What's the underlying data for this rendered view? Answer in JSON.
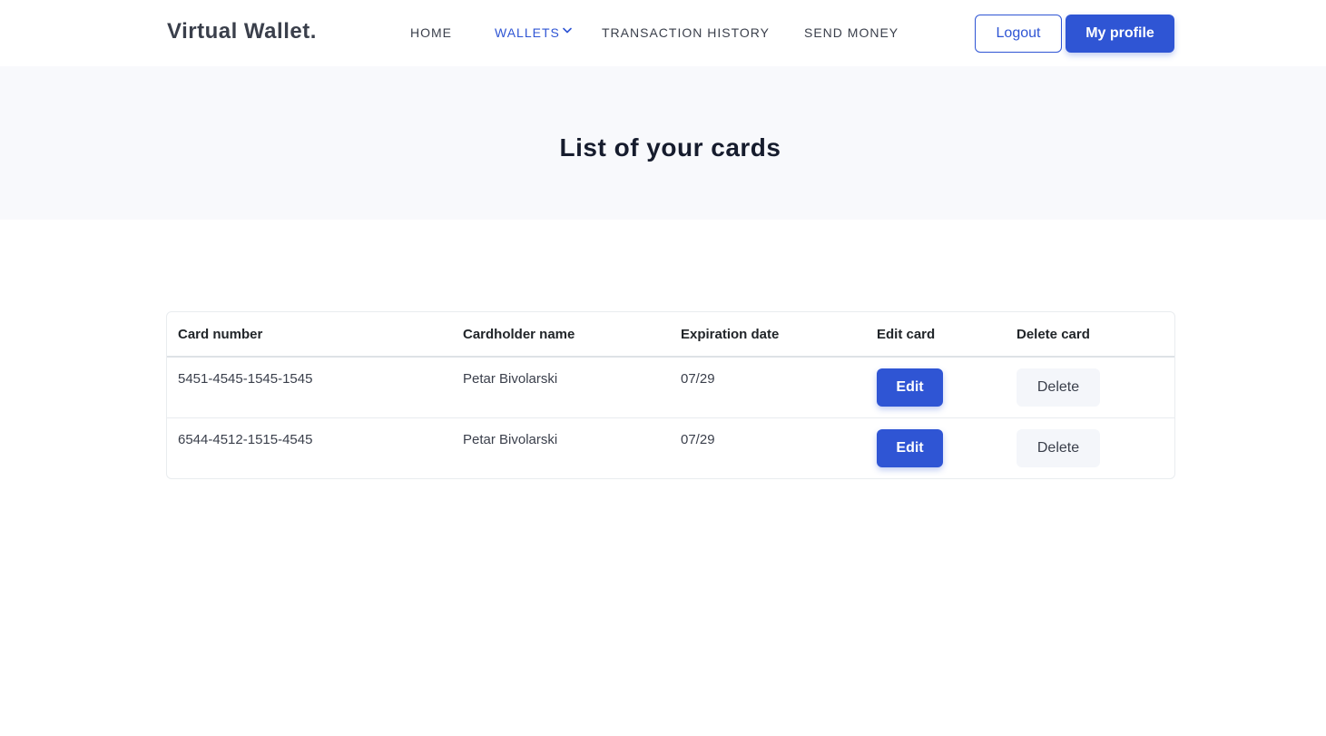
{
  "header": {
    "brand": "Virtual Wallet.",
    "nav": {
      "home": "HOME",
      "wallets": "WALLETS",
      "transaction_history": "TRANSACTION HISTORY",
      "send_money": "SEND MONEY"
    },
    "logout_label": "Logout",
    "profile_label": "My profile"
  },
  "hero": {
    "title": "List of your cards"
  },
  "table": {
    "columns": [
      "Card number",
      "Cardholder name",
      "Expiration date",
      "Edit card",
      "Delete card"
    ],
    "rows": [
      {
        "card_number": "5451-4545-1545-1545",
        "cardholder": "Petar Bivolarski",
        "expiration": "07/29",
        "edit_label": "Edit",
        "delete_label": "Delete"
      },
      {
        "card_number": "6544-4512-1515-4545",
        "cardholder": "Petar Bivolarski",
        "expiration": "07/29",
        "edit_label": "Edit",
        "delete_label": "Delete"
      }
    ]
  },
  "colors": {
    "primary": "#2f55d4",
    "hero_bg": "#f8f9fc",
    "text_dark": "#161c2d"
  },
  "icons": {
    "wallets_dropdown": "chevron-down-icon"
  }
}
